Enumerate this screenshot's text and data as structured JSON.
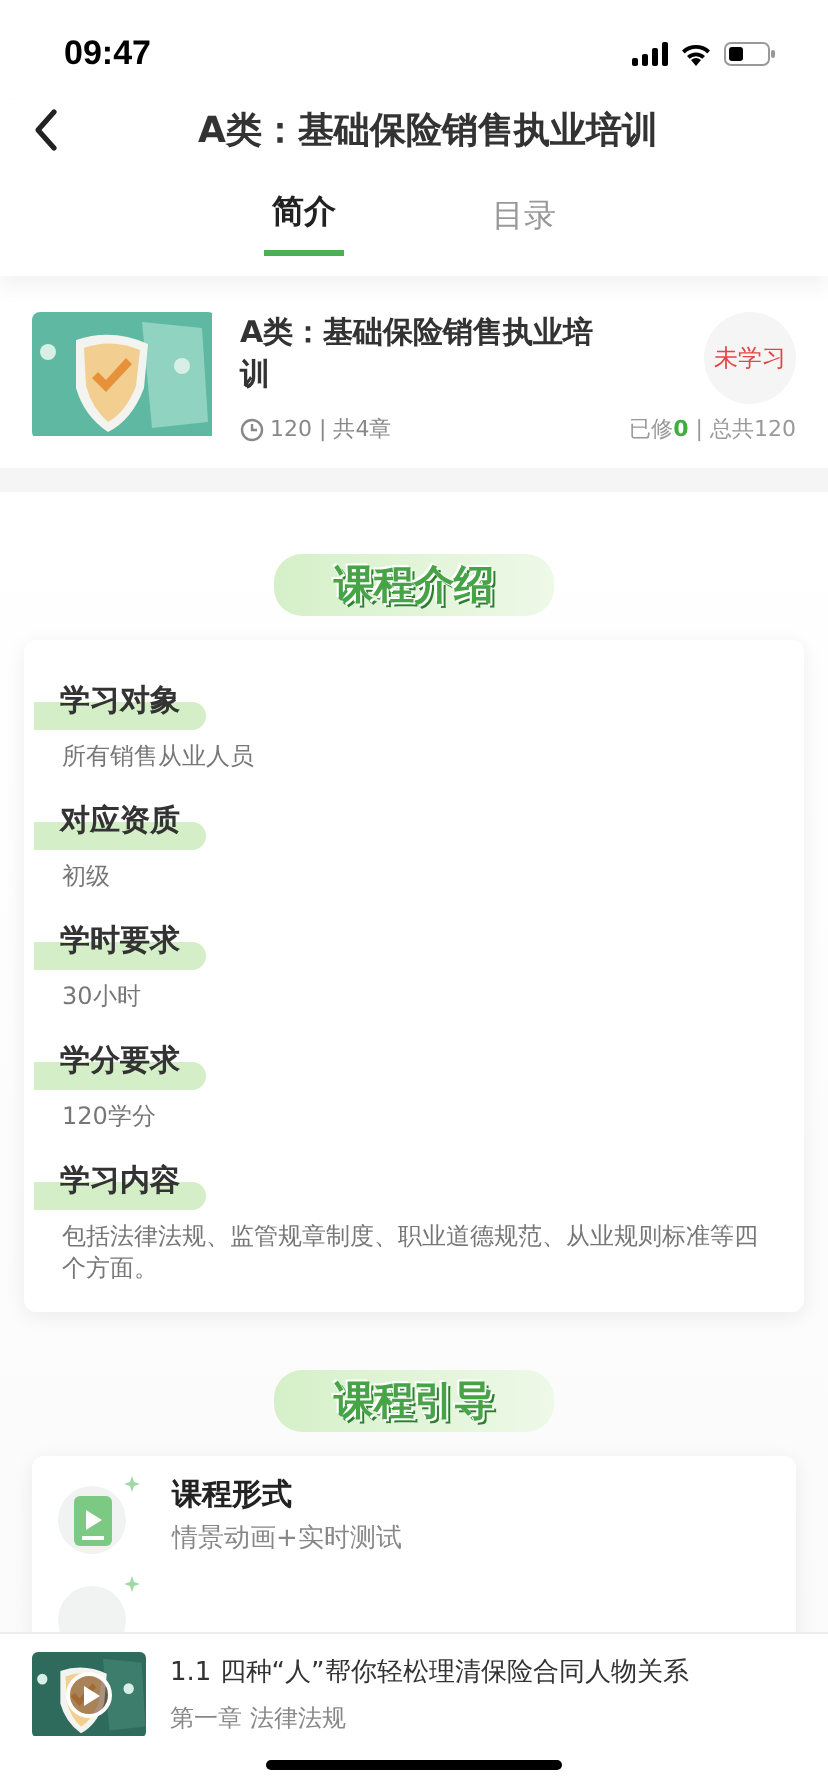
{
  "status_bar": {
    "time": "09:47"
  },
  "nav": {
    "title": "A类：基础保险销售执业培训"
  },
  "tabs": [
    {
      "label": "简介",
      "selected": true
    },
    {
      "label": "目录",
      "selected": false
    }
  ],
  "course": {
    "title": "A类：基础保险销售执业培训",
    "meta": "120 | 共4章",
    "status": "未学习",
    "progress": "已修**0** | 总共120"
  },
  "intro": {
    "title": "课程介绍",
    "items": [
      {
        "label": "学习对象",
        "value": "所有销售从业人员"
      },
      {
        "label": "对应资质",
        "value": "初级"
      },
      {
        "label": "学时要求",
        "value": "30小时"
      },
      {
        "label": "学分要求",
        "value": "120学分"
      },
      {
        "label": "学习内容",
        "value": "包括法律法规、监管规章制度、职业道德规范、从业规则标准等四个方面。"
      }
    ]
  },
  "guide": {
    "title": "课程引导",
    "items": [
      {
        "title": "课程形式",
        "subtitle": "情景动画+实时测试"
      }
    ]
  },
  "player": {
    "title": "1.1 四种“人”帮你轻松理清保险合同人物关系",
    "subtitle": "第一章 法律法规"
  }
}
